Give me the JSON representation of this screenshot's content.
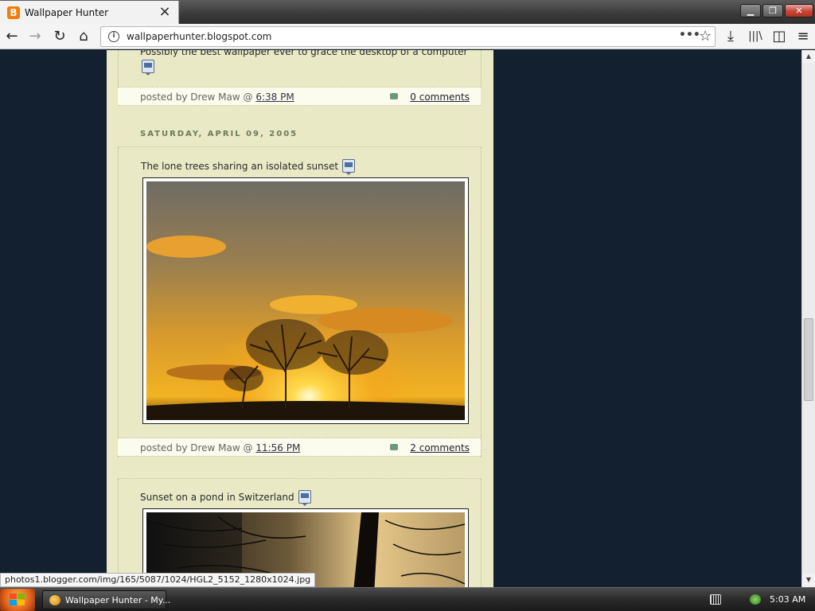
{
  "browser": {
    "tab": {
      "title": "Wallpaper Hunter",
      "favicon": "blogger-icon",
      "close": "×"
    },
    "window_buttons": {
      "minimize": "▁",
      "restore": "❐",
      "close": "✕"
    },
    "nav": {
      "back": "←",
      "forward": "→",
      "reload": "↻",
      "home": "⌂",
      "url": "wallpaperhunter.blogspot.com",
      "page_actions": "•••",
      "bookmark": "☆",
      "downloads": "⤓",
      "library": "|||\\",
      "sidebar": "◫",
      "menu": "≡"
    }
  },
  "blog": {
    "post_top": {
      "text": "Possibly the best wallpaper ever to grace the desktop of a computer",
      "author_line": "posted by Drew Maw @ ",
      "time": "6:38 PM",
      "comments": "0 comments"
    },
    "date_header": "SATURDAY, APRIL 09, 2005",
    "post_sunset": {
      "title": "The lone trees sharing an isolated sunset",
      "author_line": "posted by Drew Maw @ ",
      "time": "11:56 PM",
      "comments": "2 comments"
    },
    "post_pond": {
      "title": "Sunset on a pond in Switzerland"
    }
  },
  "status_url": "photos1.blogger.com/img/165/5087/1024/HGL2_5152_1280x1024.jpg",
  "taskbar": {
    "task_label": "Wallpaper Hunter - My...",
    "clock": "5:03 AM"
  },
  "colors": {
    "page_background": "#13202f",
    "column_background": "#e9e9c6",
    "footer_bar": "#fbfbee",
    "date_header": "#6d7a5a"
  }
}
